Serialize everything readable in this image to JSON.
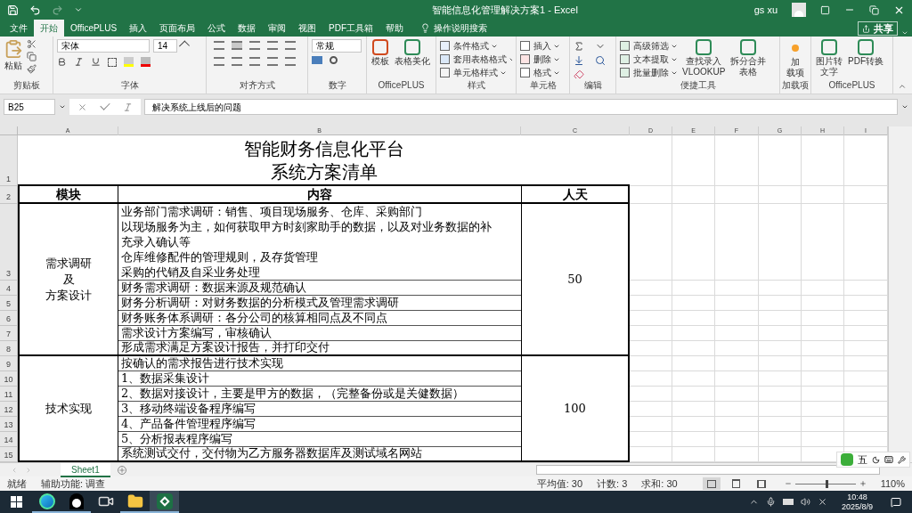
{
  "window": {
    "title": "智能信息化管理解决方案1 - Excel",
    "user": "gs xu"
  },
  "menu_tabs": [
    {
      "label": "文件",
      "selected": false
    },
    {
      "label": "开始",
      "selected": true
    },
    {
      "label": "OfficePLUS",
      "selected": false
    },
    {
      "label": "插入",
      "selected": false
    },
    {
      "label": "页面布局",
      "selected": false
    },
    {
      "label": "公式",
      "selected": false
    },
    {
      "label": "数据",
      "selected": false
    },
    {
      "label": "审阅",
      "selected": false
    },
    {
      "label": "视图",
      "selected": false
    },
    {
      "label": "PDF工具箱",
      "selected": false
    },
    {
      "label": "帮助",
      "selected": false
    }
  ],
  "tell_me": "操作说明搜索",
  "share_button": "共享",
  "ribbon": {
    "clipboard": {
      "label": "剪贴板",
      "paste": "粘贴"
    },
    "font": {
      "label": "字体",
      "font_name": "宋体",
      "font_size": "14"
    },
    "alignment": {
      "label": "对齐方式"
    },
    "number": {
      "label": "数字",
      "format": "常规"
    },
    "officeplus": {
      "label": "OfficePLUS",
      "buttons": [
        "模板",
        "表格美化"
      ]
    },
    "styles": {
      "label": "样式",
      "items": [
        "条件格式",
        "套用表格格式",
        "单元格样式"
      ]
    },
    "cells": {
      "label": "单元格",
      "items": [
        "插入",
        "删除",
        "格式"
      ]
    },
    "editing": {
      "label": "编辑"
    },
    "quick_tools": {
      "label": "便捷工具",
      "items": [
        "高级筛选",
        "文本提取",
        "批量删除"
      ],
      "large": [
        [
          "查找录入",
          "VLOOKUP"
        ],
        [
          "拆分合并",
          "表格"
        ]
      ]
    },
    "addins": {
      "label": "加载项",
      "lines": [
        "加",
        "载项"
      ]
    },
    "officeplus2": {
      "label": "OfficePLUS",
      "large": [
        [
          "图片转",
          "文字"
        ],
        [
          "PDF转换"
        ]
      ]
    }
  },
  "formula_bar": {
    "name_box": "B25",
    "formula": "解决系统上线后的问题"
  },
  "columns": [
    "A",
    "B",
    "C",
    "D",
    "E",
    "F",
    "G",
    "H",
    "I"
  ],
  "sheet": {
    "title": {
      "row": "1",
      "lines": [
        "智能财务信息化平台",
        "系统方案清单"
      ]
    },
    "header": {
      "row": "2",
      "cells": [
        "模块",
        "内容",
        "人天"
      ]
    },
    "sections": [
      {
        "module_lines": [
          "需求调研",
          "及",
          "方案设计"
        ],
        "days": "50",
        "rows": [
          {
            "row": "3",
            "lines": [
              "业务部门需求调研：销售、项目现场服务、仓库、采购部门",
              "以现场服务为主，如何获取甲方时刻家助手的数据，以及对业务数据的补",
              "充录入确认等",
              "仓库维修配件的管理规则，及存货管理",
              "采购的代销及自采业务处理"
            ]
          },
          {
            "row": "4",
            "lines": [
              "财务需求调研：数据来源及规范确认"
            ]
          },
          {
            "row": "5",
            "lines": [
              "财务分析调研：对财务数据的分析模式及管理需求调研"
            ]
          },
          {
            "row": "6",
            "lines": [
              "财务账务体系调研：各分公司的核算相同点及不同点"
            ]
          },
          {
            "row": "7",
            "lines": [
              "需求设计方案编写，审核确认"
            ]
          },
          {
            "row": "8",
            "lines": [
              "形成需求满足方案设计报告，并打印交付"
            ]
          }
        ]
      },
      {
        "module_lines": [
          "技术实现"
        ],
        "days": "100",
        "rows": [
          {
            "row": "9",
            "lines": [
              "按确认的需求报告进行技术实现"
            ]
          },
          {
            "row": "10",
            "lines": [
              "1、数据采集设计"
            ]
          },
          {
            "row": "11",
            "lines": [
              "2、数据对接设计，主要是甲方的数据，（完整备份或是关健数据）"
            ]
          },
          {
            "row": "12",
            "lines": [
              "3、移动终端设备程序编写"
            ]
          },
          {
            "row": "13",
            "lines": [
              "4、产品备件管理程序编写"
            ]
          },
          {
            "row": "14",
            "lines": [
              "5、分析报表程序编写"
            ]
          },
          {
            "row": "15",
            "lines": [
              "系统测试交付，交付物为乙方服务器数据库及测试域名网站"
            ]
          }
        ]
      }
    ]
  },
  "sheet_tabs": [
    {
      "label": "Sheet1",
      "selected": true
    }
  ],
  "ime_toolbar": {
    "mode": "五"
  },
  "status_bar": {
    "ready": "就绪",
    "accessibility": "辅助功能: 调查",
    "stats": [
      "平均值: 30",
      "计数: 3",
      "求和: 30"
    ],
    "views": [
      {
        "kind": "normal",
        "selected": true
      },
      {
        "kind": "page-layout",
        "selected": false
      },
      {
        "kind": "page-break",
        "selected": false
      }
    ],
    "zoom": {
      "level": 0.5,
      "label": "110%"
    }
  },
  "taskbar": {
    "apps": [
      {
        "kind": "browser",
        "running": true,
        "selected": false
      },
      {
        "kind": "penguin",
        "running": true,
        "selected": false
      },
      {
        "kind": "camera",
        "running": false,
        "selected": false
      },
      {
        "kind": "folder",
        "running": true,
        "selected": false
      },
      {
        "kind": "excel",
        "running": true,
        "selected": true
      }
    ],
    "time": "10:48",
    "date": "2025/8/9"
  }
}
